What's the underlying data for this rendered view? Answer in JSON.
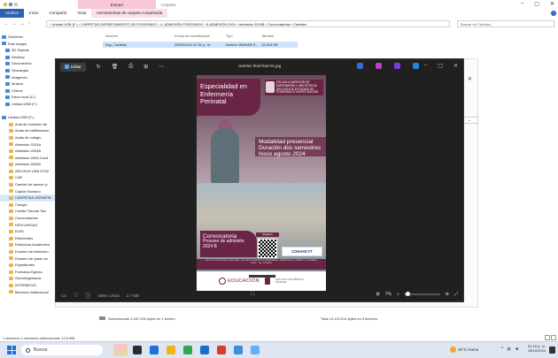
{
  "explorer": {
    "context_tab": "Extraer",
    "context_tab_right": "Carpeta",
    "ribbon_tabs": [
      "Archivo",
      "Inicio",
      "Compartir",
      "Vista",
      "Herramientas de carpeta comprimida"
    ],
    "address": "› Unidad USB (F:) › CARPETAS-DEPARTAMENTO DE POSGRADO › 4. ADMISIÓN POSGRADO › 5-ADMISIÓN 2024 › Admisión 2024B › Convocatorias › Carteles",
    "search_placeholder": "Buscar en Carteles",
    "columns": [
      "Nombre",
      "Fecha de modificación",
      "Tipo",
      "Tamaño"
    ],
    "file": {
      "name": "Esp_Carteles",
      "date": "25/02/2024 01:31 p. m.",
      "type": "Archivo WinRAR Z...",
      "size": "12,819 KB"
    },
    "status_selected": "Seleccionado 3,057,202 bytes en 1 fichero",
    "status_total": "Total 13,125,014 bytes en 3 ficheros",
    "status_bottom": "1 elemento    1 elemento seleccionado  12,5 MB"
  },
  "sidebar": {
    "items": [
      {
        "label": "OneDrive",
        "kind": "top"
      },
      {
        "label": "Este equipo",
        "kind": "top"
      },
      {
        "label": "3D Objects",
        "kind": "top"
      },
      {
        "label": "Desktop",
        "kind": "top"
      },
      {
        "label": "Documentos",
        "kind": "top"
      },
      {
        "label": "Descargas",
        "kind": "top"
      },
      {
        "label": "Imágenes",
        "kind": "top"
      },
      {
        "label": "Música",
        "kind": "top"
      },
      {
        "label": "Vídeos",
        "kind": "top"
      },
      {
        "label": "Disco local (C:)",
        "kind": "top"
      },
      {
        "label": "Unidad USB (F:)",
        "kind": "top"
      },
      {
        "label": "",
        "kind": "gap"
      },
      {
        "label": "Unidad USB (F:)",
        "kind": "top"
      },
      {
        "label": "Acta de comisión de",
        "kind": "folder"
      },
      {
        "label": "Actas de calificacione",
        "kind": "folder"
      },
      {
        "label": "Actas de colegio",
        "kind": "folder"
      },
      {
        "label": "Admisión 2024A",
        "kind": "folder"
      },
      {
        "label": "Admisión 2024B",
        "kind": "folder"
      },
      {
        "label": "Admisión 2024-Cond",
        "kind": "folder"
      },
      {
        "label": "Admisión 2025A",
        "kind": "folder"
      },
      {
        "label": "ARCHIVS USB 07/02",
        "kind": "folder"
      },
      {
        "label": "CAE",
        "kind": "folder"
      },
      {
        "label": "Cambio de asesor y/",
        "kind": "folder"
      },
      {
        "label": "Capital Humano",
        "kind": "folder"
      },
      {
        "label": "CARPETAS-DEPARTA",
        "kind": "folder",
        "selected": true
      },
      {
        "label": "Colegio",
        "kind": "folder"
      },
      {
        "label": "Comite Tutorial Teci",
        "kind": "folder"
      },
      {
        "label": "Convocatorias",
        "kind": "folder"
      },
      {
        "label": "DESCARGAS",
        "kind": "folder"
      },
      {
        "label": "EGEL",
        "kind": "folder"
      },
      {
        "label": "Efemérides",
        "kind": "folder"
      },
      {
        "label": "Estructura Académica",
        "kind": "folder"
      },
      {
        "label": "Examen de Admisión",
        "kind": "folder"
      },
      {
        "label": "Examen de grado  se",
        "kind": "folder"
      },
      {
        "label": "Expedientes",
        "kind": "folder"
      },
      {
        "label": "Formatos Egreso",
        "kind": "folder"
      },
      {
        "label": "Gerontogeriatría",
        "kind": "folder"
      },
      {
        "label": "INTERMOVS",
        "kind": "folder"
      },
      {
        "label": "Memoria Institucional",
        "kind": "folder"
      }
    ]
  },
  "viewer": {
    "title": "carteles final final-01.jpg",
    "edit_label": "Editar",
    "dimensions": "1956 x 2610",
    "file_size": "2.7 MB",
    "zoom": "7%",
    "zoom_fraction": 0.07,
    "app_colors": [
      "#2f6fd6",
      "#c33bc1",
      "#7a3ddb",
      "#1e88e5"
    ]
  },
  "poster": {
    "title": "Especialidad en Enfermería Perinatal",
    "school": "ESCUELA SUPERIOR DE ENFERMERÍA Y OBSTETRICIA",
    "school_sub": "SECCIÓN DE ESTUDIOS DE POSGRADO E INVESTIGACIÓN",
    "modalidad": "Modalidad presencial Duración dos semestres Inicio agosto 2024",
    "conv_title": "Convocatoria",
    "conv_sub": "Proceso de admisión 2024 B",
    "qr_label": "Registro",
    "conahcyt": "CONAHCYT",
    "info_strip": "INSTITUTO POLITÉCNICO NACIONAL · ESCUELA SUPERIOR DE ENFERMERÍA Y OBSTETRICIA · CONTACTO: POSGRADO ESEO · TEL. 57296000",
    "edu_logo": "EDUCACIÓN",
    "ver_text": "INSTITUTO POLITÉCNICO NACIONAL"
  },
  "taskbar": {
    "search_placeholder": "Buscar",
    "weather": "20°C  Humo",
    "time": "01:10 p. m.",
    "date": "16/10/2024",
    "app_colors": [
      "#2b2b2b",
      "#1a73d6",
      "#f1b31a",
      "#2fa84f",
      "#1b6ed1",
      "#d83b2f",
      "#3c8dde",
      "#5fb0ff"
    ]
  }
}
